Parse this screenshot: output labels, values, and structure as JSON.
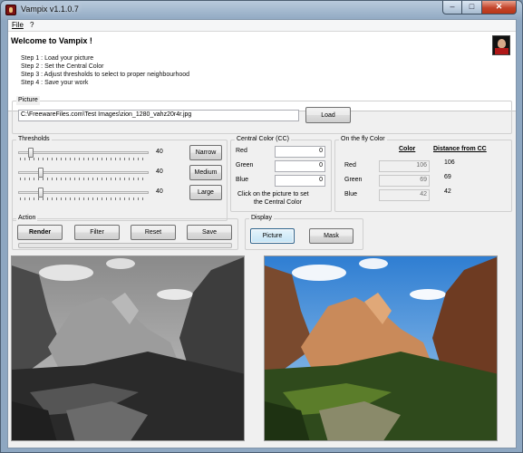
{
  "window": {
    "title": "Vampix v1.1.0.7"
  },
  "menu": {
    "file": "File",
    "help": "?"
  },
  "welcome": {
    "title": "Welcome to Vampix !",
    "steps": [
      "Step 1 : Load your picture",
      "Step 2 : Set the Central Color",
      "Step 3 : Adjust thresholds to select to proper neighbourhood",
      "Step 4 : Save your work"
    ]
  },
  "picture": {
    "group_label": "Picture",
    "path": "C:\\FreewareFiles.com\\Test Images\\zion_1280_vahz20r4r.jpg",
    "load_label": "Load"
  },
  "thresholds": {
    "group_label": "Thresholds",
    "sliders": [
      {
        "value": "40",
        "level": 0.08
      },
      {
        "value": "40",
        "level": 0.16
      },
      {
        "value": "40",
        "level": 0.16
      }
    ],
    "narrow_label": "Narrow",
    "medium_label": "Medium",
    "large_label": "Large"
  },
  "central_color": {
    "group_label": "Central Color (CC)",
    "red_label": "Red",
    "green_label": "Green",
    "blue_label": "Blue",
    "red_value": "0",
    "green_value": "0",
    "blue_value": "0",
    "hint_line1": "Click on the picture to set",
    "hint_line2": "the Central Color"
  },
  "on_the_fly": {
    "group_label": "On the fly Color",
    "color_header": "Color",
    "distance_header": "Distance from CC",
    "red_label": "Red",
    "green_label": "Green",
    "blue_label": "Blue",
    "red_value": "106",
    "green_value": "69",
    "blue_value": "42",
    "red_distance": "106",
    "green_distance": "69",
    "blue_distance": "42"
  },
  "action": {
    "group_label": "Action",
    "render_label": "Render",
    "filter_label": "Filter",
    "reset_label": "Reset",
    "save_label": "Save",
    "progress": 0.0
  },
  "display": {
    "group_label": "Display",
    "picture_label": "Picture",
    "mask_label": "Mask"
  },
  "icons": {
    "app": "vampix-app-icon",
    "logo": "vampix-logo-icon"
  }
}
